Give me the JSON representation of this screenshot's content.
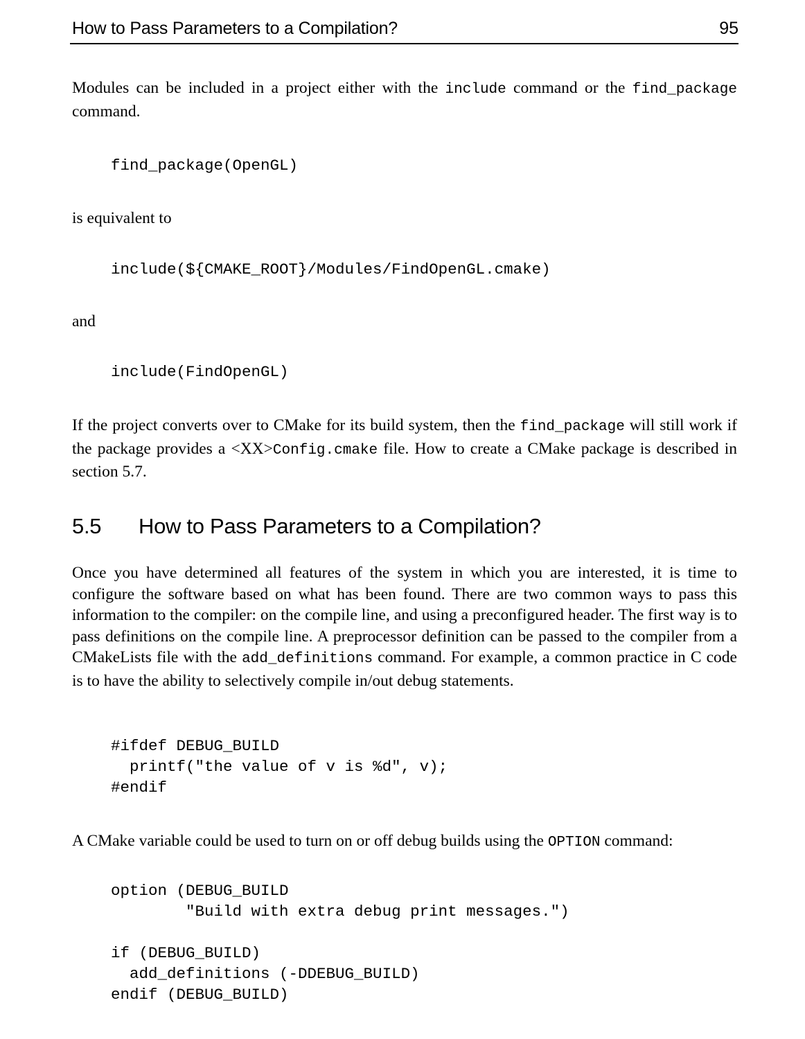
{
  "header": {
    "title": "How to Pass Parameters to a Compilation?",
    "page_number": "95"
  },
  "body": {
    "para1": {
      "t1": "Modules can be included in a project either with the ",
      "c1": "include",
      "t2": " command or the ",
      "c2": "find_package",
      "t3": " command."
    },
    "code1": "find_package(OpenGL)",
    "para2": "is equivalent to",
    "code2": "include(${CMAKE_ROOT}/Modules/FindOpenGL.cmake)",
    "para3": "and",
    "code3": "include(FindOpenGL)",
    "para4": {
      "t1": "If the project converts over to CMake for its build system, then the ",
      "c1": "find_package",
      "t2": " will still work if the package provides a <XX>",
      "c2": "Config.cmake",
      "t3": " file. How to create a CMake package is described in section 5.7."
    },
    "section": {
      "number": "5.5",
      "title": "How to Pass Parameters to a Compilation?"
    },
    "para5": {
      "t1": "Once you have determined all features of the system in which you are interested, it is time to configure the software based on what has been found. There are two common ways to pass this information to the compiler: on the compile line, and using a preconfigured header. The first way is to pass definitions on the compile line. A preprocessor definition can be passed to the compiler from a CMakeLists file with the ",
      "c1": "add_definitions",
      "t2": " command. For example, a common practice in C code is to have the ability to selectively compile in/out debug statements."
    },
    "code4": "#ifdef DEBUG_BUILD\n  printf(\"the value of v is %d\", v);\n#endif",
    "para6": {
      "t1": "A CMake variable could be used to turn on or off debug builds using the ",
      "c1": "OPTION",
      "t2": " command:"
    },
    "code5": "option (DEBUG_BUILD\n        \"Build with extra debug print messages.\")",
    "code6": "if (DEBUG_BUILD)\n  add_definitions (-DDEBUG_BUILD)\nendif (DEBUG_BUILD)"
  },
  "colors": {
    "text": "#000000",
    "background": "#ffffff",
    "rule": "#000000"
  }
}
